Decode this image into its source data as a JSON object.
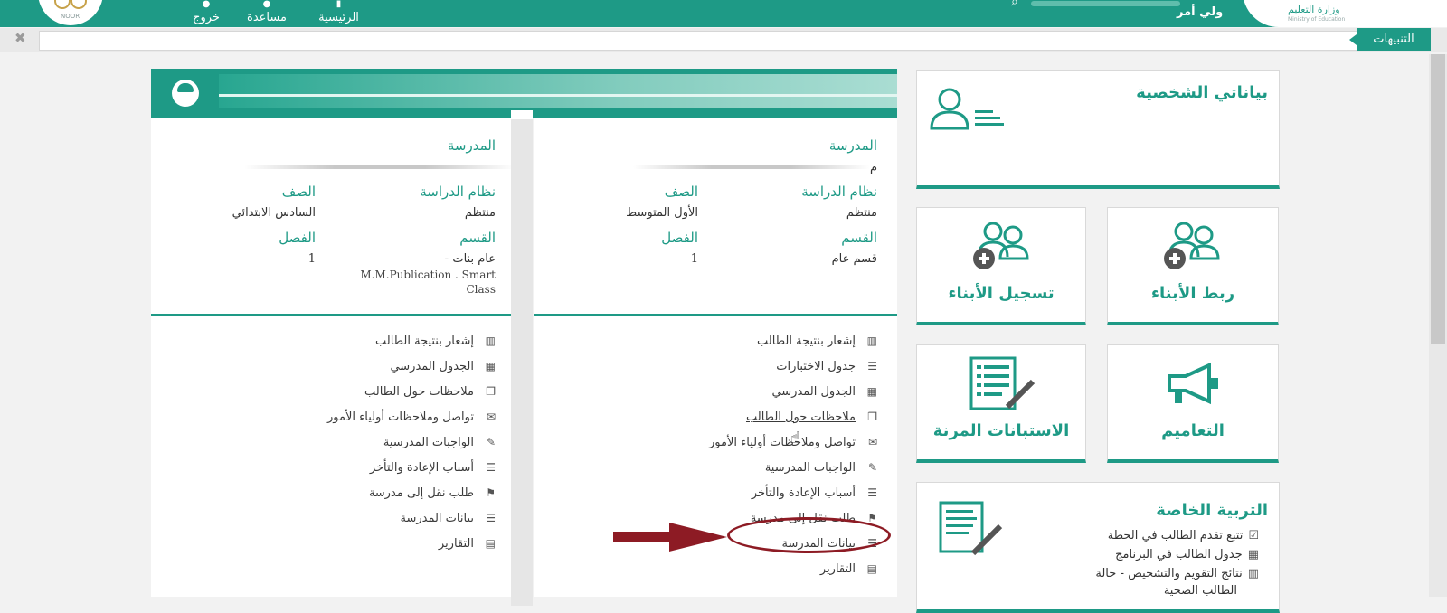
{
  "topbar": {
    "logo_left_text": "NOOR",
    "logo_right_line1": "وزارة التعليم",
    "logo_right_line2": "Ministry of Education",
    "nav": [
      {
        "label": "الرئيسية",
        "icon": "home-icon"
      },
      {
        "label": "مساعدة",
        "icon": "help-icon"
      },
      {
        "label": "خروج",
        "icon": "logout-icon"
      }
    ],
    "user_role": "ولي أمر"
  },
  "alerts": {
    "label": "التنبيهات",
    "close": "✖"
  },
  "students": [
    {
      "school_label": "المدرسة",
      "school_value": "م",
      "system_label": "نظام الدراسة",
      "system_value": "منتظم",
      "grade_label": "الصف",
      "grade_value": "الأول المتوسط",
      "section_label": "القسم",
      "section_value": "قسم عام",
      "class_label": "الفصل",
      "class_value": "1",
      "menu": [
        {
          "label": "إشعار بنتيجة الطالب",
          "icon": "bar-chart-icon"
        },
        {
          "label": "جدول الاختبارات",
          "icon": "list-icon"
        },
        {
          "label": "الجدول المدرسي",
          "icon": "calendar-icon"
        },
        {
          "label": "ملاحظات حول الطالب",
          "icon": "copy-icon"
        },
        {
          "label": "تواصل وملاحظات أولياء الأمور",
          "icon": "envelope-icon"
        },
        {
          "label": "الواجبات المدرسية",
          "icon": "edit-icon"
        },
        {
          "label": "أسباب الإعادة والتأخر",
          "icon": "list-icon"
        },
        {
          "label": "طلب نقل إلى مدرسة",
          "icon": "flag-icon"
        },
        {
          "label": "بيانات المدرسة",
          "icon": "list-icon"
        },
        {
          "label": "التقارير",
          "icon": "file-icon"
        }
      ]
    },
    {
      "school_label": "المدرسة",
      "system_label": "نظام الدراسة",
      "system_value": "منتظم",
      "grade_label": "الصف",
      "grade_value": "السادس الابتدائي",
      "section_label": "القسم",
      "section_value": "عام بنات -",
      "section_extra": "M.M.Publication . Smart Class",
      "class_label": "الفصل",
      "class_value": "1",
      "menu": [
        {
          "label": "إشعار بنتيجة الطالب",
          "icon": "bar-chart-icon"
        },
        {
          "label": "الجدول المدرسي",
          "icon": "calendar-icon"
        },
        {
          "label": "ملاحظات حول الطالب",
          "icon": "copy-icon"
        },
        {
          "label": "تواصل وملاحظات أولياء الأمور",
          "icon": "envelope-icon"
        },
        {
          "label": "الواجبات المدرسية",
          "icon": "edit-icon"
        },
        {
          "label": "أسباب الإعادة والتأخر",
          "icon": "list-icon"
        },
        {
          "label": "طلب نقل إلى مدرسة",
          "icon": "flag-icon"
        },
        {
          "label": "بيانات المدرسة",
          "icon": "list-icon"
        },
        {
          "label": "التقارير",
          "icon": "file-icon"
        }
      ]
    }
  ],
  "dashboard": {
    "profile_title": "بياناتي الشخصية",
    "tiles": {
      "link_children": "ربط الأبناء",
      "register_children": "تسجيل الأبناء",
      "circulars": "التعاميم",
      "flexible_surveys": "الاستبانات المرنة"
    },
    "special_ed": {
      "title": "التربية الخاصة",
      "items": [
        {
          "label": "تتبع تقدم الطالب في الخطة",
          "icon": "calendar-check-icon"
        },
        {
          "label": "جدول الطالب في البرنامج",
          "icon": "calendar-icon"
        },
        {
          "label": "نتائج التقويم والتشخيص - حالة",
          "icon": "bar-chart-icon"
        },
        {
          "label": "الطالب الصحية",
          "icon": ""
        }
      ]
    }
  },
  "annotation": {
    "color": "#8d1b24"
  }
}
